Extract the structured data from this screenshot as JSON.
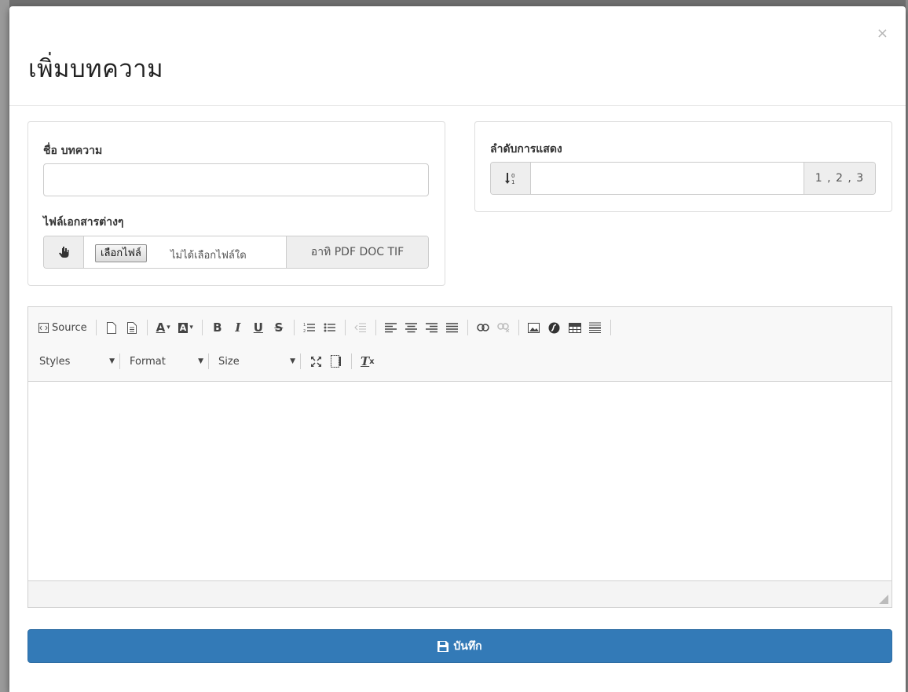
{
  "modal": {
    "title": "เพิ่มบทความ",
    "close_glyph": "×"
  },
  "article_form": {
    "name_label": "ชื่อ บทความ",
    "name_value": "",
    "files_label": "ไฟล์เอกสารต่างๆ",
    "choose_file_label": "เลือกไฟล์",
    "no_file_text": "ไม่ได้เลือกไฟล์ใด",
    "file_types_hint": "อาทิ PDF DOC TIF",
    "upload_icon": "upload-hand-icon"
  },
  "order_form": {
    "label": "ลำดับการแสดง",
    "value": "",
    "hint": "1 , 2 , 3",
    "sort_icon": "sort-numeric-icon"
  },
  "editor": {
    "source_label": "Source",
    "styles_label": "Styles",
    "format_label": "Format",
    "size_label": "Size",
    "toolbar_row1_icons": [
      "source-icon",
      "new-page-icon",
      "templates-icon",
      "text-color-icon",
      "bg-color-icon",
      "bold-icon",
      "italic-icon",
      "underline-icon",
      "strike-icon",
      "numbered-list-icon",
      "bulleted-list-icon",
      "outdent-icon",
      "align-left-icon",
      "align-center-icon",
      "align-right-icon",
      "justify-icon",
      "link-icon",
      "unlink-icon",
      "image-icon",
      "flash-icon",
      "table-icon",
      "horizontal-rule-icon"
    ],
    "toolbar_row2_icons": [
      "maximize-icon",
      "show-blocks-icon",
      "remove-format-icon"
    ],
    "content": ""
  },
  "footer": {
    "save_label": "บันทึก",
    "save_icon": "floppy-disk-icon"
  },
  "colors": {
    "primary": "#337ab7",
    "addon_bg": "#eeeeee",
    "border": "#cccccc"
  }
}
